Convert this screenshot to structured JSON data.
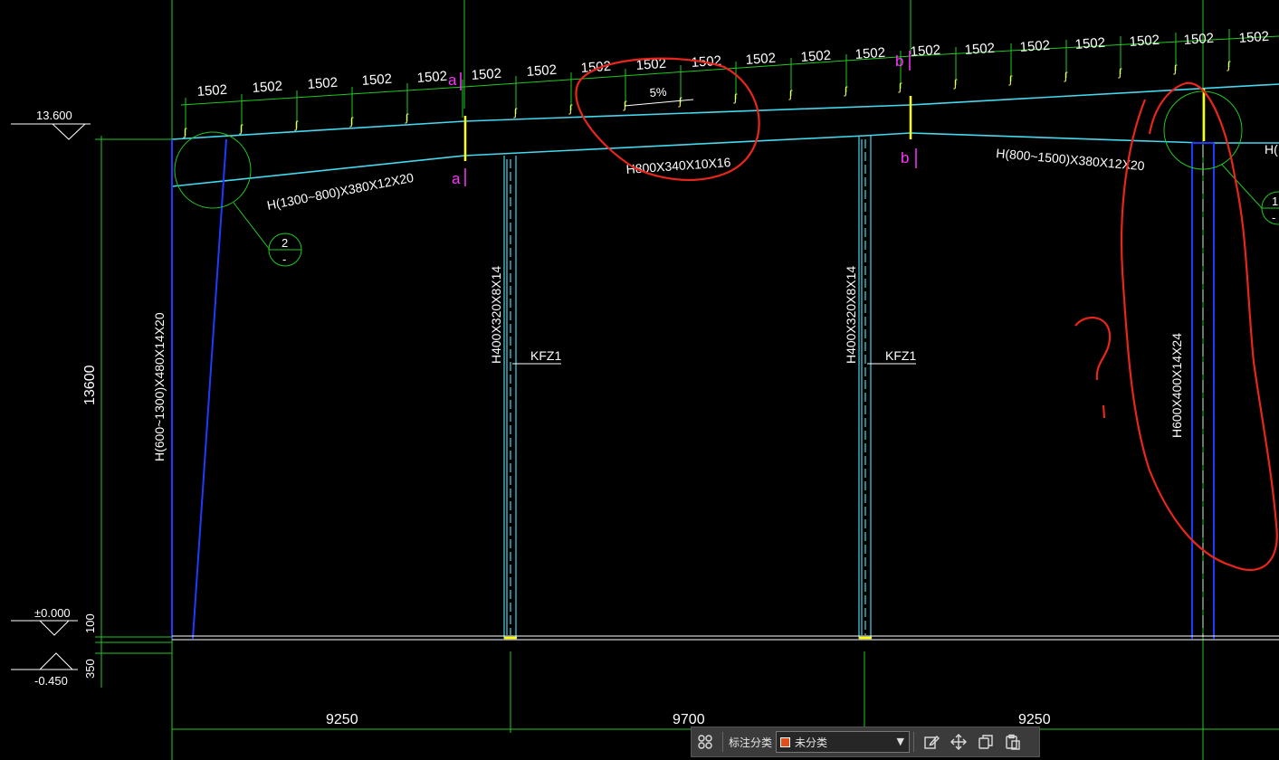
{
  "drawing": {
    "top_beam_dims": [
      "1502",
      "1502",
      "1502",
      "1502",
      "1502",
      "1502",
      "1502",
      "1502",
      "1502",
      "1502",
      "1502",
      "1502",
      "1502",
      "1502",
      "1502",
      "1502",
      "1502",
      "1502",
      "1502",
      "1502"
    ],
    "slope": "5%",
    "section_a": "a",
    "section_b": "b",
    "beam_left": "H(1300~800)X380X12X20",
    "beam_mid": "H800X340X10X16",
    "beam_right": "H(800~1500)X380X12X20",
    "beam_right_cut": "H(",
    "column_left": "H(600~1300)X480X14X20",
    "column_mid1": "H400X320X8X14",
    "column_mid2": "H400X320X8X14",
    "column_right": "H600X400X14X24",
    "column_tag1": "KFZ1",
    "column_tag2": "KFZ1",
    "detail_2_num": "2",
    "detail_2_sub": "-",
    "detail_1_num": "1",
    "detail_1_sub": "-",
    "elev_top": "13.600",
    "elev_zero": "±0.000",
    "elev_bottom": "-0.450",
    "height_total": "13600",
    "height_100": "100",
    "height_350": "350",
    "bay1": "9250",
    "bay2": "9700",
    "bay3": "9250",
    "annotation_question": "?"
  },
  "toolbar": {
    "category_label": "标注分类",
    "category_value": "未分类",
    "swatch_color": "#e0501c"
  },
  "colors": {
    "background": "#000000",
    "green": "#22c822",
    "cyan": "#46d8ee",
    "blue": "#1f3bff",
    "magenta": "#ff33ff",
    "yellow": "#ffff00",
    "red_markup": "#e8261c"
  }
}
